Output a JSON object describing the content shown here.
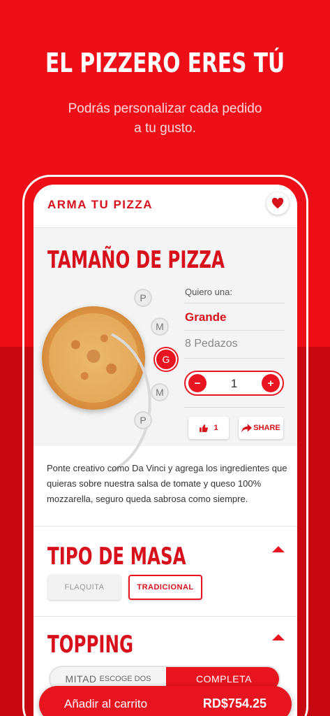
{
  "hero": {
    "title": "EL PIZZERO ERES TÚ",
    "subtitle_line1": "Podrás personalizar cada pedido",
    "subtitle_line2": "a tu gusto."
  },
  "header": {
    "title": "ARMA TU PIZZA",
    "favorite_icon": "heart-icon"
  },
  "size_section": {
    "title": "TAMAÑO DE PIZZA",
    "size_options": [
      "P",
      "M",
      "G",
      "M",
      "P"
    ],
    "selected_index": 2,
    "prompt": "Quiero una:",
    "selected_size": "Grande",
    "pieces": "8 Pedazos",
    "quantity": "1",
    "minus_label": "−",
    "plus_label": "+",
    "likes": "1",
    "share_label": "SHARE"
  },
  "description": "Ponte creativo como Da Vinci y agrega los ingredientes que quieras sobre nuestra salsa de tomate y queso 100% mozzarella, seguro queda sabrosa como siempre.",
  "dough_section": {
    "title": "TIPO DE MASA",
    "options": [
      "FLAQUITA",
      "TRADICIONAL"
    ],
    "selected": "TRADICIONAL"
  },
  "topping_section": {
    "title": "TOPPING",
    "half_label": "MITAD",
    "half_hint": "ESCOGE DOS",
    "full_label": "COMPLETA",
    "selected": "COMPLETA"
  },
  "cart": {
    "label": "Añadir al carrito",
    "price": "RD$754.25"
  },
  "colors": {
    "brand_red": "#e8141f",
    "background_red": "#ee0e17",
    "dark_red": "#c70811"
  }
}
